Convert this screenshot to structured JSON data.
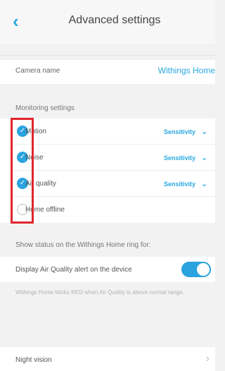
{
  "header": {
    "back_icon": "chevron-left-icon",
    "title": "Advanced settings"
  },
  "camera": {
    "label": "Camera name",
    "value": "Withings Home"
  },
  "monitoring": {
    "section_label": "Monitoring settings",
    "items": [
      {
        "label": "Motion",
        "checked": true,
        "sensitivity": "Sensitivity"
      },
      {
        "label": "Noise",
        "checked": true,
        "sensitivity": "Sensitivity"
      },
      {
        "label": "Air quality",
        "checked": true,
        "sensitivity": "Sensitivity"
      },
      {
        "label": "Home offline",
        "checked": false,
        "sensitivity": ""
      }
    ]
  },
  "ring_status": {
    "section_label": "Show status on the Withings Home ring for:",
    "toggle_label": "Display Air Quality alert on the device",
    "toggle_on": true,
    "note": "Withings Home blinks RED when Air Quality is above normal range."
  },
  "night_vision": {
    "label": "Night vision",
    "arrow_icon": "chevron-right-icon"
  },
  "colors": {
    "accent": "#29a8e0",
    "highlight": "#e0262e"
  }
}
